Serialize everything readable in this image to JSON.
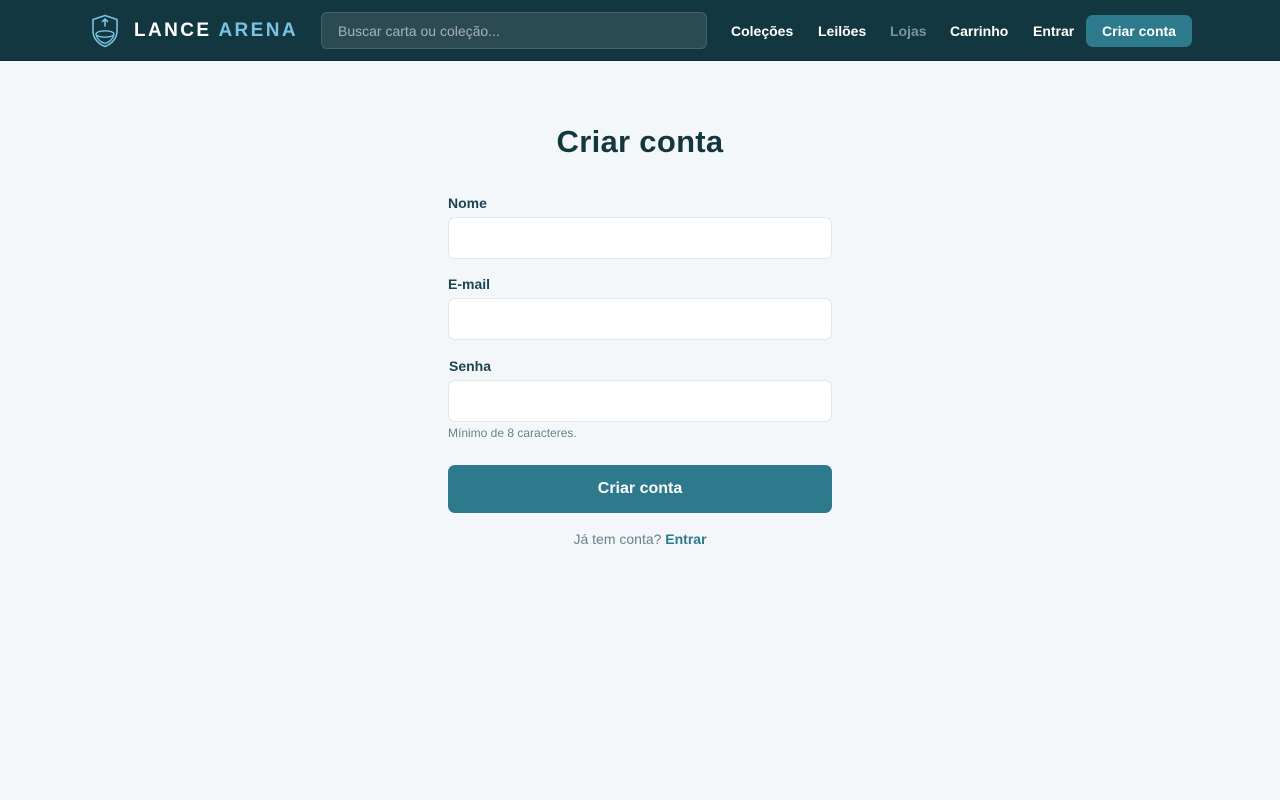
{
  "header": {
    "logo": {
      "word1": "LANCE",
      "word2": "ARENA",
      "icon": "shield-icon"
    },
    "search": {
      "placeholder": "Buscar carta ou coleção...",
      "value": ""
    },
    "nav": [
      {
        "label": "Coleções",
        "state": "normal"
      },
      {
        "label": "Leilões",
        "state": "normal"
      },
      {
        "label": "Lojas",
        "state": "muted"
      },
      {
        "label": "Carrinho",
        "state": "normal"
      },
      {
        "label": "Entrar",
        "state": "normal"
      }
    ],
    "cta_label": "Criar conta"
  },
  "form": {
    "title": "Criar conta",
    "fields": [
      {
        "label": "Nome",
        "value": ""
      },
      {
        "label": "E-mail",
        "value": ""
      },
      {
        "label": "Senha",
        "value": ""
      }
    ],
    "password_hint": "Mínimo de 8 caracteres.",
    "submit_label": "Criar conta",
    "login_prompt": "Já tem conta?",
    "login_link": "Entrar"
  },
  "colors": {
    "header_bg": "#133740",
    "accent": "#2d7a8c",
    "logo_accent": "#79c2e0",
    "page_bg": "#f3f7fa",
    "muted_nav": "#7d939a"
  }
}
